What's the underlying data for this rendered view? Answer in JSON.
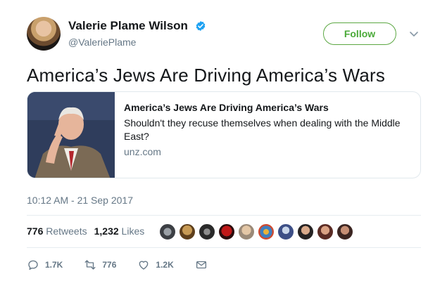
{
  "user": {
    "name": "Valerie Plame Wilson",
    "handle": "@ValeriePlame",
    "follow_label": "Follow"
  },
  "tweet": {
    "text": "America’s Jews Are Driving America’s Wars",
    "timestamp": "10:12 AM - 21 Sep 2017"
  },
  "card": {
    "title": "America’s Jews Are Driving America’s Wars",
    "description": "Shouldn't they recuse themselves when dealing with the Middle East?",
    "domain": "unz.com"
  },
  "stats": {
    "retweets_count": "776",
    "retweets_label": "Retweets",
    "likes_count": "1,232",
    "likes_label": "Likes"
  },
  "actions": {
    "reply_count": "1.7K",
    "retweet_count": "776",
    "like_count": "1.2K"
  },
  "colors": {
    "follow_green": "#4aa938",
    "verified_blue": "#1da1f2",
    "muted": "#657786"
  },
  "icons": [
    "verified-badge-icon",
    "chevron-down-icon",
    "reply-icon",
    "retweet-icon",
    "like-icon",
    "direct-message-icon"
  ]
}
